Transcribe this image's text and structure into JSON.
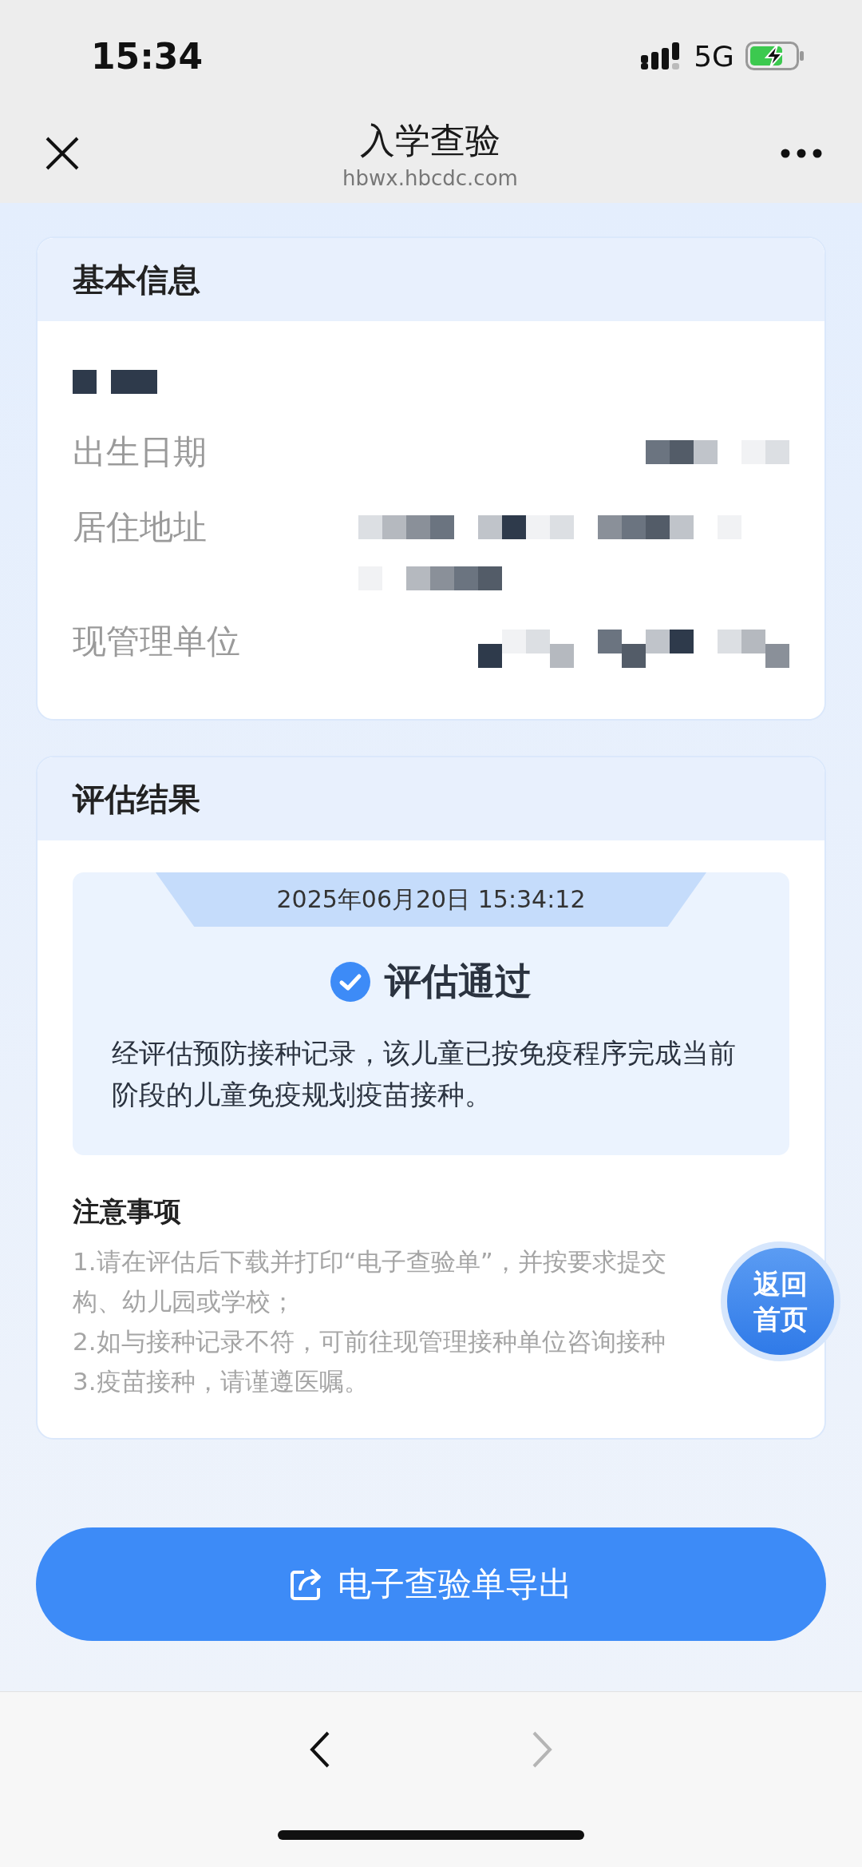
{
  "status_bar": {
    "time": "15:34",
    "network": "5G"
  },
  "nav_bar": {
    "title": "入学查验",
    "url": "hbwx.hbcdc.com"
  },
  "basic_info": {
    "title": "基本信息",
    "rows": [
      {
        "kind": "name"
      },
      {
        "kind": "field",
        "label": "出生日期"
      },
      {
        "kind": "field",
        "label": "居住地址"
      },
      {
        "kind": "field",
        "label": "现管理单位"
      }
    ]
  },
  "assessment": {
    "title": "评估结果",
    "timestamp": "2025年06月20日 15:34:12",
    "result": "评估通过",
    "passed": true,
    "description": "经评估预防接种记录，该儿童已按免疫程序完成当前阶段的儿童免疫规划疫苗接种。",
    "notes_title": "注意事项",
    "notes": [
      "1.请在评估后下载并打印“电子查验单”，并按要求提交",
      "构、幼儿园或学校；",
      "2.如与接种记录不符，可前往现管理接种单位咨询接种",
      "3.疫苗接种，请谨遵医嘱。"
    ]
  },
  "home_button": {
    "lines": [
      "返回",
      "首页"
    ]
  },
  "export_button": {
    "label": "电子查验单导出"
  },
  "toolbar": [
    {
      "kind": "back",
      "disabled": false
    },
    {
      "kind": "forward",
      "disabled": true
    }
  ]
}
